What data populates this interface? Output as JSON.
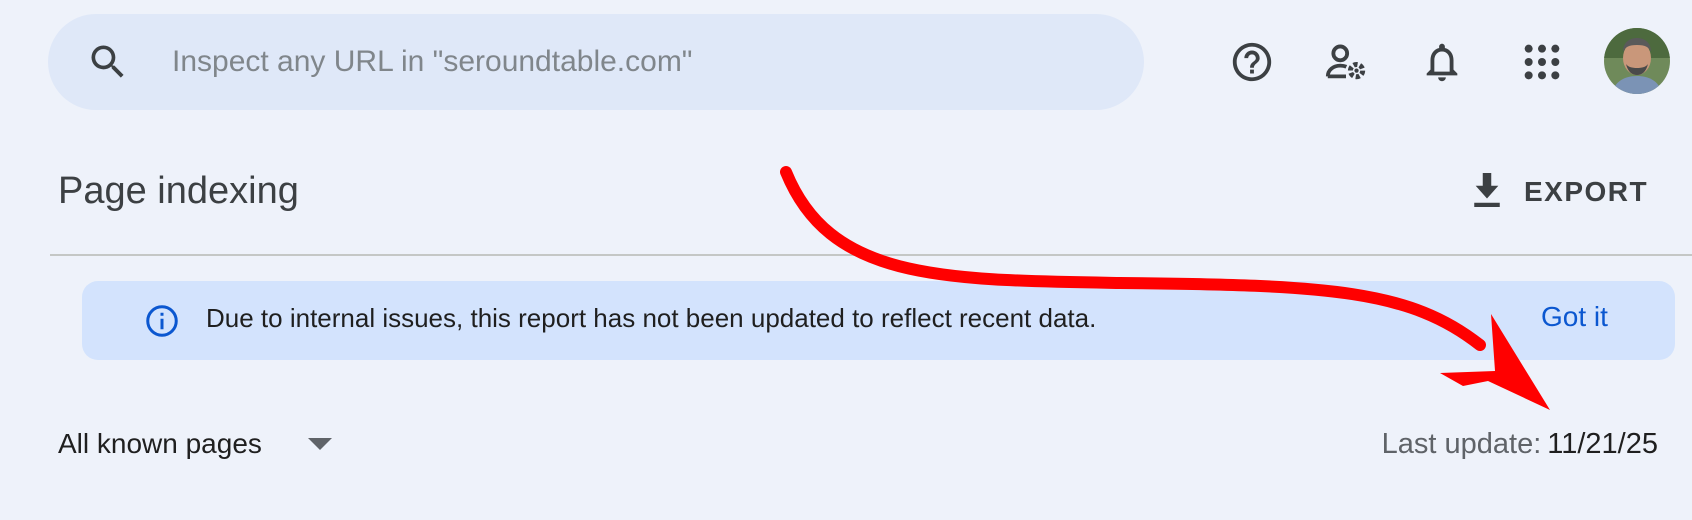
{
  "search": {
    "placeholder": "Inspect any URL in \"seroundtable.com\"",
    "value": ""
  },
  "toolbar": {
    "icons": [
      "help-icon",
      "manage-users-icon",
      "notifications-icon",
      "apps-grid-icon",
      "avatar"
    ]
  },
  "page": {
    "title": "Page indexing",
    "export_label": "EXPORT"
  },
  "banner": {
    "icon": "info-icon",
    "message": "Due to internal issues, this report has not been updated to reflect recent data.",
    "action_label": "Got it"
  },
  "filter": {
    "selected": "All known pages"
  },
  "update": {
    "label": "Last update:",
    "value": "11/21/25"
  },
  "annotation": {
    "type": "red-arrow",
    "color": "#ff0000"
  },
  "colors": {
    "background": "#eef2fa",
    "search_bg": "#dfe8f8",
    "banner_bg": "#d3e3fd",
    "accent_blue": "#0b57d0",
    "icon_gray": "#5f6368"
  }
}
